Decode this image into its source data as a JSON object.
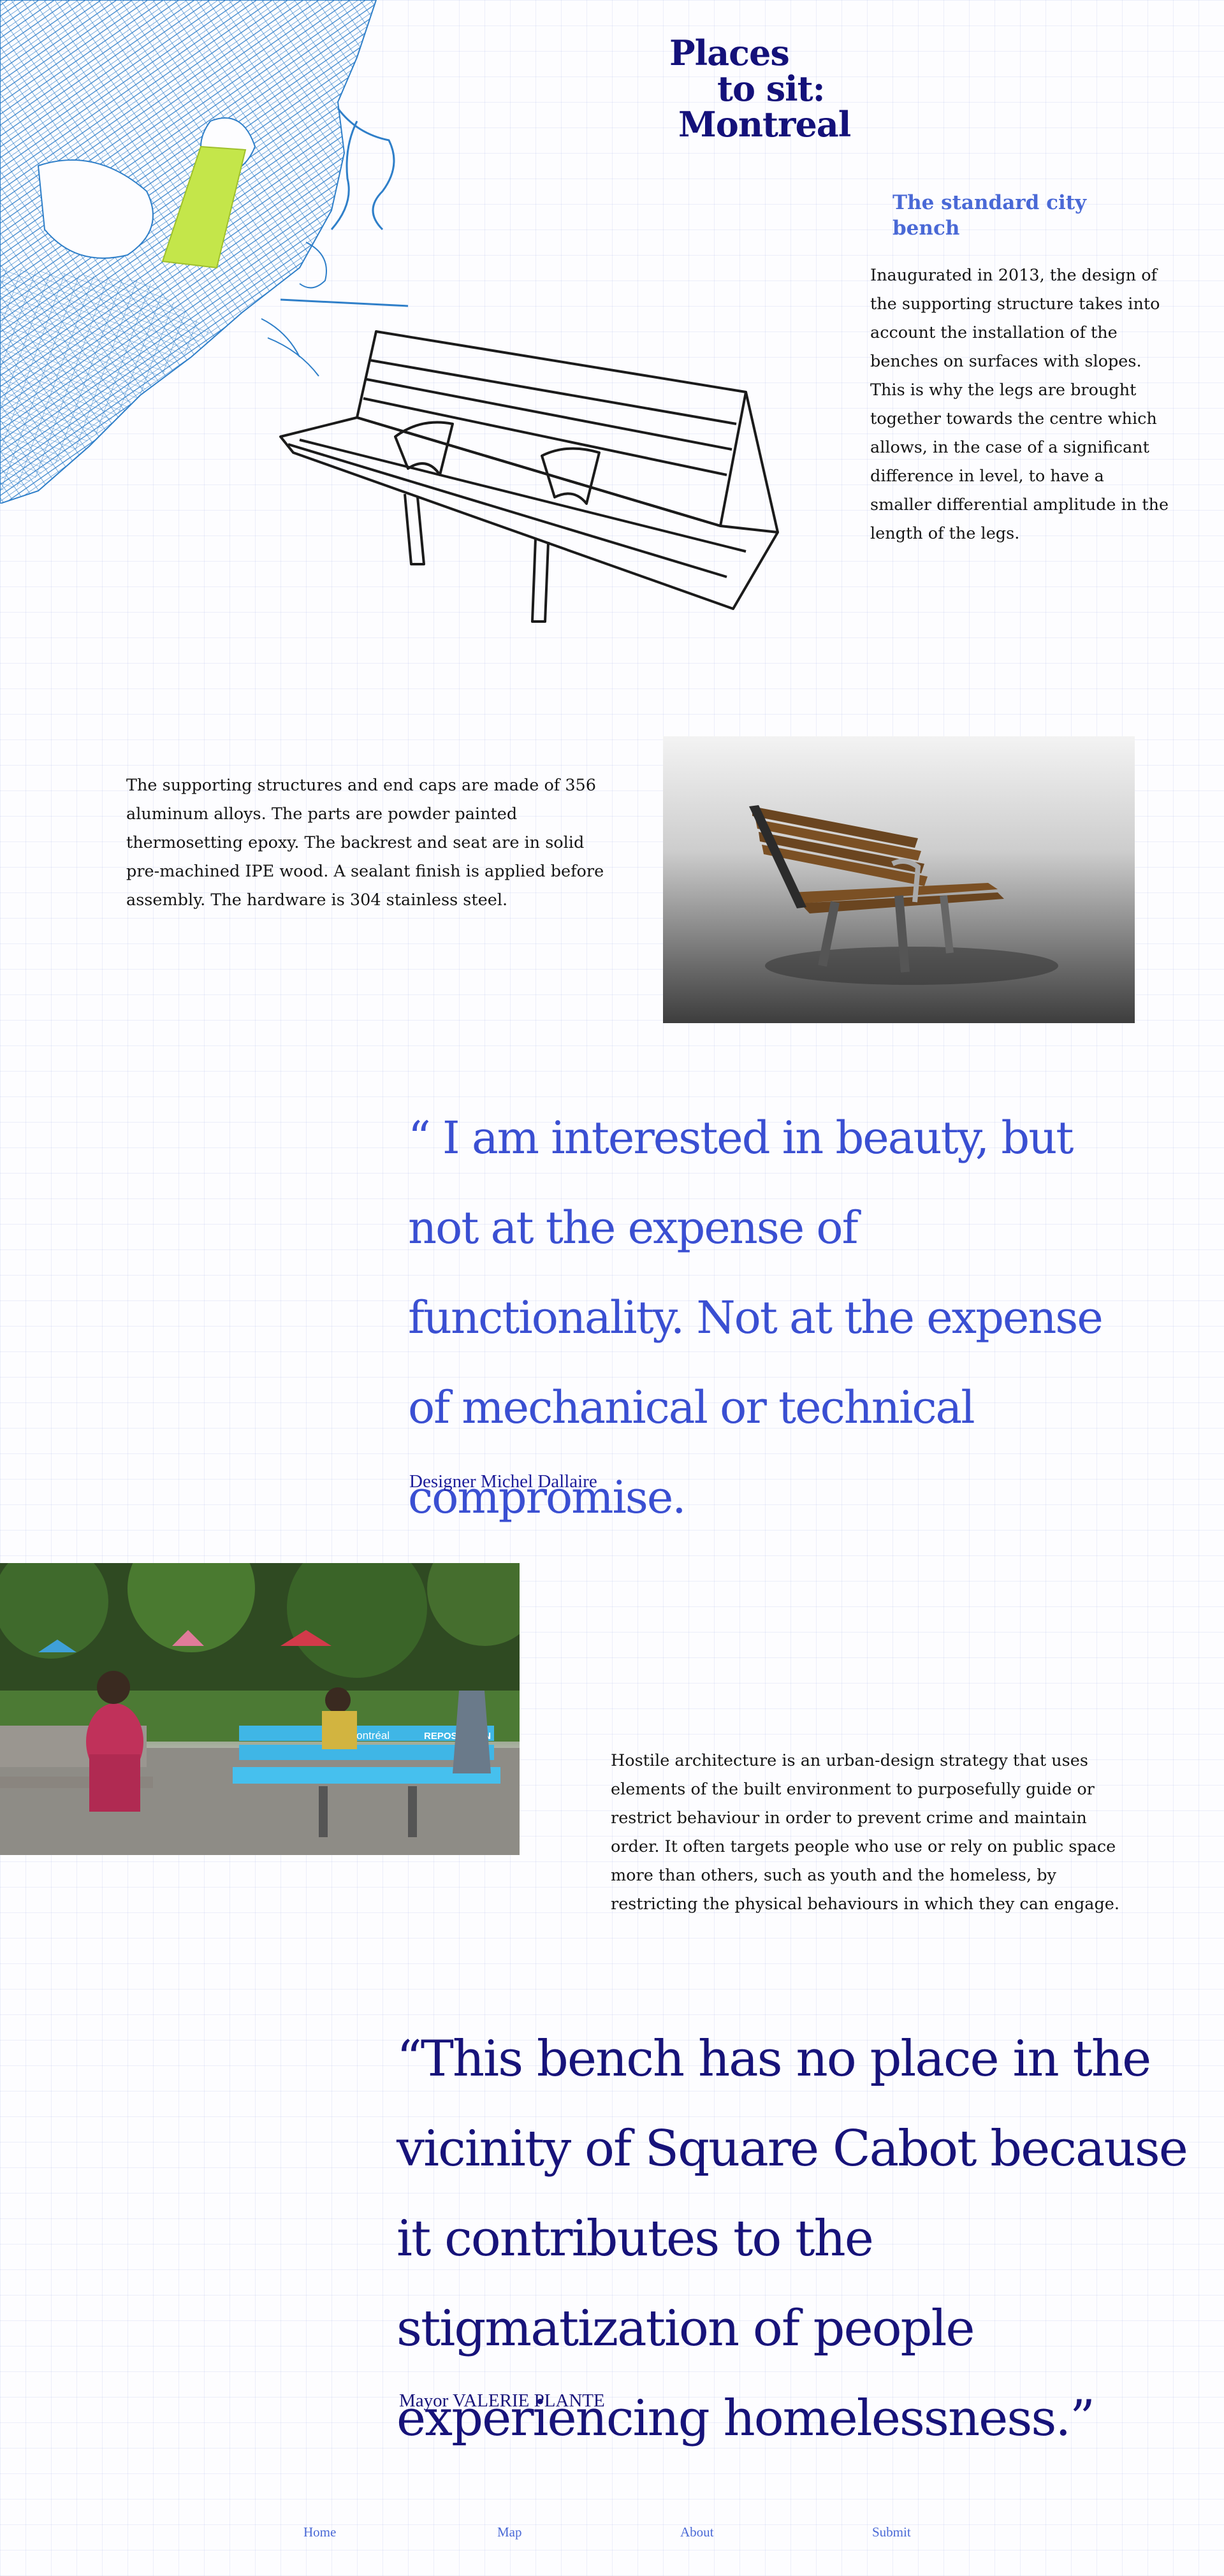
{
  "title": {
    "line1": "Places",
    "line2": "to sit:",
    "line3": "Montreal"
  },
  "subtitle": "The standard city bench",
  "intro": "Inaugurated in 2013, the design of the supporting structure takes into account the installation of the benches on surfaces with slopes. This is why the legs are brought together towards the centre which allows, in the case of a significant difference in level, to have a smaller differential amplitude in the length of the legs.",
  "materials": "The supporting structures and end caps are made of 356 aluminum alloys. The parts are powder painted thermosetting epoxy. The backrest and seat are in solid pre-machined IPE wood. A sealant finish is applied before assembly. The hardware is 304 stainless steel.",
  "quote1": {
    "text": "“ I am interested in beauty, but not at the expense of functionality. Not at the expense of mechanical or technical compromise.",
    "author": "Designer Michel Dallaire"
  },
  "hostile": "Hostile architecture is an urban-design strategy that uses elements of the built environment to purposefully guide or restrict behaviour in order to prevent crime and maintain order. It often targets people who use or rely on public space more than others, such as youth and the homeless, by restricting the physical behaviours in which they can engage.",
  "quote2": {
    "text": "“This bench has no place in the vicinity of Square Cabot because it contributes to the stigmatization of people experiencing homelessness.”",
    "author": "Mayor VALERIE PLANTE"
  },
  "photo_text": {
    "bench_logo": "Montréal",
    "bench_sign": "REPOS 15 MIN"
  },
  "footer": {
    "home": "Home",
    "map": "Map",
    "about": "About",
    "submit": "Submit"
  },
  "colors": {
    "title": "#14117a",
    "accent": "#4a69d6",
    "quote1": "#3a4fd2",
    "quote2": "#17137a",
    "map": "#2f7fc9",
    "highlight": "#c4e64a"
  }
}
